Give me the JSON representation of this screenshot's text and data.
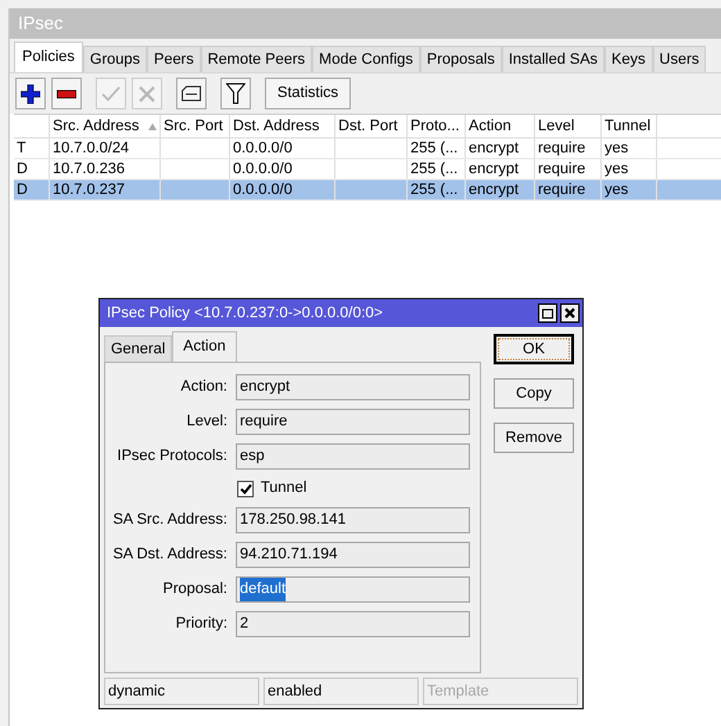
{
  "window": {
    "title": "IPsec"
  },
  "tabs": [
    {
      "label": "Policies",
      "selected": true
    },
    {
      "label": "Groups",
      "selected": false
    },
    {
      "label": "Peers",
      "selected": false
    },
    {
      "label": "Remote Peers",
      "selected": false
    },
    {
      "label": "Mode Configs",
      "selected": false
    },
    {
      "label": "Proposals",
      "selected": false
    },
    {
      "label": "Installed SAs",
      "selected": false
    },
    {
      "label": "Keys",
      "selected": false
    },
    {
      "label": "Users",
      "selected": false
    }
  ],
  "toolbar": [
    {
      "kind": "add",
      "disabled": false
    },
    {
      "kind": "remove",
      "disabled": false
    },
    {
      "kind": "enable",
      "disabled": true
    },
    {
      "kind": "disable",
      "disabled": true
    },
    {
      "kind": "comment",
      "disabled": false
    },
    {
      "kind": "filter",
      "disabled": false
    },
    {
      "kind": "text",
      "label": "Statistics",
      "disabled": false
    }
  ],
  "table": {
    "columns": [
      {
        "sorted": false
      },
      {
        "label": "Src. Address",
        "sorted": true
      },
      {
        "label": "Src. Port",
        "sorted": false
      },
      {
        "label": "Dst. Address",
        "sorted": false
      },
      {
        "label": "Dst. Port",
        "sorted": false
      },
      {
        "label": "Proto...",
        "sorted": false
      },
      {
        "label": "Action",
        "sorted": false
      },
      {
        "label": "Level",
        "sorted": false
      },
      {
        "label": "Tunnel",
        "sorted": false
      }
    ],
    "rows": [
      {
        "cells": [
          "T",
          "10.7.0.0/24",
          "",
          "0.0.0.0/0",
          "",
          "255 (...",
          "encrypt",
          "require",
          "yes"
        ],
        "selected": false
      },
      {
        "cells": [
          "D",
          "10.7.0.236",
          "",
          "0.0.0.0/0",
          "",
          "255 (...",
          "encrypt",
          "require",
          "yes"
        ],
        "selected": false
      },
      {
        "cells": [
          "D",
          "10.7.0.237",
          "",
          "0.0.0.0/0",
          "",
          "255 (...",
          "encrypt",
          "require",
          "yes"
        ],
        "selected": true
      }
    ]
  },
  "dialog": {
    "title": "IPsec Policy <10.7.0.237:0->0.0.0.0/0:0>",
    "tabs": [
      {
        "label": "General",
        "selected": false
      },
      {
        "label": "Action",
        "selected": true
      }
    ],
    "fields": [
      {
        "kind": "text",
        "label": "Action:",
        "value": "encrypt",
        "highlighted": false
      },
      {
        "kind": "text",
        "label": "Level:",
        "value": "require",
        "highlighted": false
      },
      {
        "kind": "text",
        "label": "IPsec Protocols:",
        "value": "esp",
        "highlighted": false
      },
      {
        "kind": "checkbox",
        "label": "Tunnel",
        "checked": true
      },
      {
        "kind": "text",
        "label": "SA Src. Address:",
        "value": "178.250.98.141",
        "highlighted": false
      },
      {
        "kind": "text",
        "label": "SA Dst. Address:",
        "value": "94.210.71.194",
        "highlighted": false
      },
      {
        "kind": "text",
        "label": "Proposal:",
        "value": "default",
        "highlighted": true
      },
      {
        "kind": "text",
        "label": "Priority:",
        "value": "2",
        "highlighted": false
      }
    ],
    "buttons": [
      {
        "label": "OK",
        "focused": true
      },
      {
        "label": "Copy",
        "focused": false
      },
      {
        "label": "Remove",
        "focused": false
      }
    ],
    "status": [
      {
        "text": "dynamic",
        "disabled": false
      },
      {
        "text": "enabled",
        "disabled": false
      },
      {
        "text": "Template",
        "disabled": true
      }
    ]
  }
}
